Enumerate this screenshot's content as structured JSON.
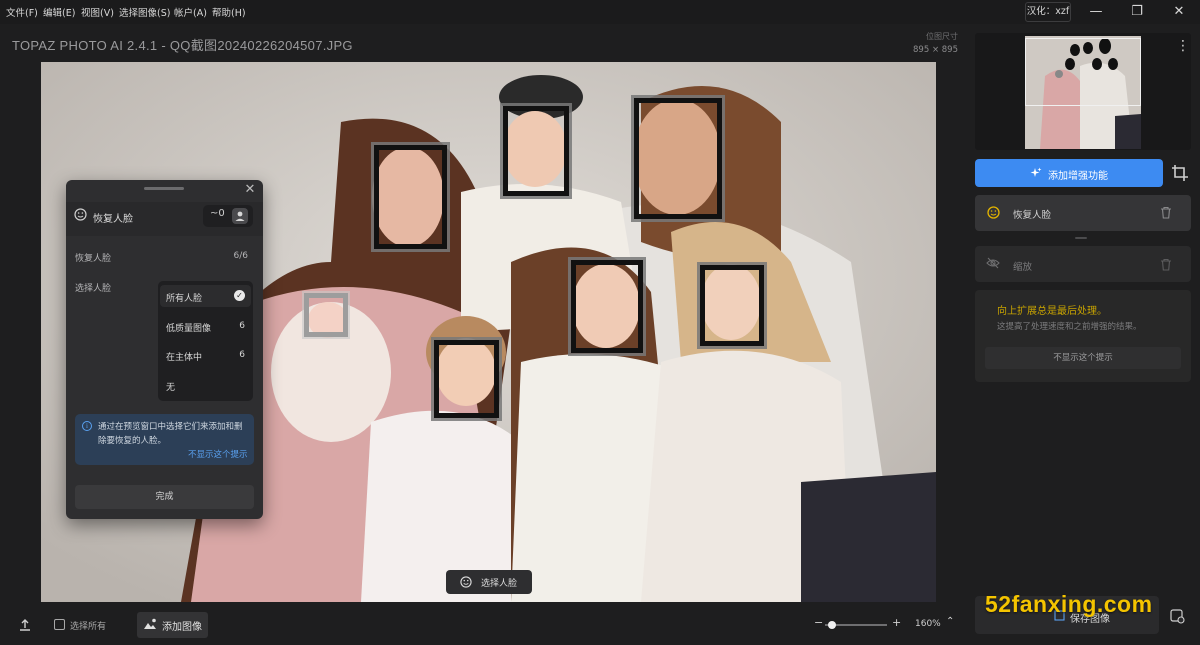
{
  "menu": [
    "文件(F)",
    "编辑(E)",
    "视图(V)",
    "选择图像(S)",
    "帐户(A)",
    "帮助(H)"
  ],
  "hanhua": "汉化：xzf",
  "window": {
    "minimize": "—",
    "restore": "❐",
    "close": "✕"
  },
  "app_title": "TOPAZ PHOTO AI 2.4.1 - QQ截图20240226204507.JPG",
  "image_info": {
    "label": "位图尺寸",
    "dimensions": "895 × 895"
  },
  "restore_panel": {
    "title": "恢复人脸",
    "toggle_value": "~0",
    "restore_faces_label": "恢复人脸",
    "restore_faces_count": "6/6",
    "select_faces_label": "选择人脸",
    "options": [
      {
        "label": "所有人脸",
        "count": "",
        "selected": true
      },
      {
        "label": "低质量图像",
        "count": "6",
        "selected": false
      },
      {
        "label": "在主体中",
        "count": "6",
        "selected": false
      },
      {
        "label": "无",
        "count": "",
        "selected": false
      }
    ],
    "info_text": "通过在预览窗口中选择它们来添加和删除要恢复的人脸。",
    "info_link": "不显示这个提示",
    "done_label": "完成"
  },
  "select_face_button": "选择人脸",
  "right_panel": {
    "add_enhancement": "添加增强功能",
    "features": [
      {
        "label": "恢复人脸",
        "active": true,
        "icon": "face-smile-icon"
      },
      {
        "label": "缩放",
        "active": false,
        "icon": "eye-off-icon"
      }
    ],
    "tip_title": "向上扩展总是最后处理。",
    "tip_body": "这提高了处理速度和之前增强的结果。",
    "tip_button": "不显示这个提示"
  },
  "bottom_bar": {
    "select_all": "选择所有",
    "add_image": "添加图像",
    "zoom_percent": "160%",
    "zoom_level": 0.12,
    "save_label": "保存图像"
  },
  "watermark": "52fanxing.com",
  "colors": {
    "accent": "#3d8bf2",
    "tip_title": "#c9a400",
    "background": "#1e1e1f",
    "panel": "#2e2e30",
    "watermark": "#f4c400"
  }
}
